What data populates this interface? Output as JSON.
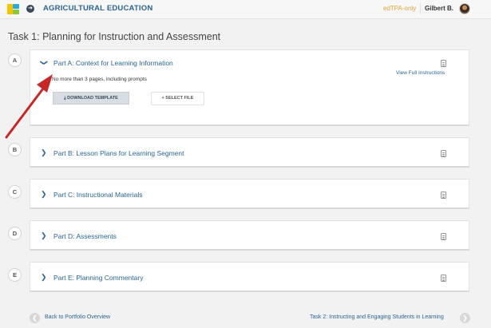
{
  "header": {
    "program_icon": "circle-arrow-icon",
    "program_title": "AGRICULTURAL EDUCATION",
    "mode": "edTPA-only",
    "user_name": "Gilbert B."
  },
  "task": {
    "title": "Task 1: Planning for Instruction and Assessment"
  },
  "parts": [
    {
      "letter": "A",
      "title": "Part A: Context for Learning Information",
      "expanded": true,
      "view_link": "View Full Instructions",
      "requirement": "No more than 3 pages, including prompts",
      "download_label": "⤓ DOWNLOAD TEMPLATE",
      "select_label": "+ SELECT FILE"
    },
    {
      "letter": "B",
      "title": "Part B: Lesson Plans for Learning Segment",
      "expanded": false
    },
    {
      "letter": "C",
      "title": "Part C: Instructional Materials",
      "expanded": false
    },
    {
      "letter": "D",
      "title": "Part D: Assessments",
      "expanded": false
    },
    {
      "letter": "E",
      "title": "Part E: Planning Commentary",
      "expanded": false
    }
  ],
  "footer": {
    "back_label": "Back to Portfolio Overview",
    "next_label": "Task 2: Instructing and Engaging Students in Learning"
  },
  "colors": {
    "link": "#2a6496",
    "mode": "#e6a23c",
    "annotation_arrow": "#c62828"
  }
}
